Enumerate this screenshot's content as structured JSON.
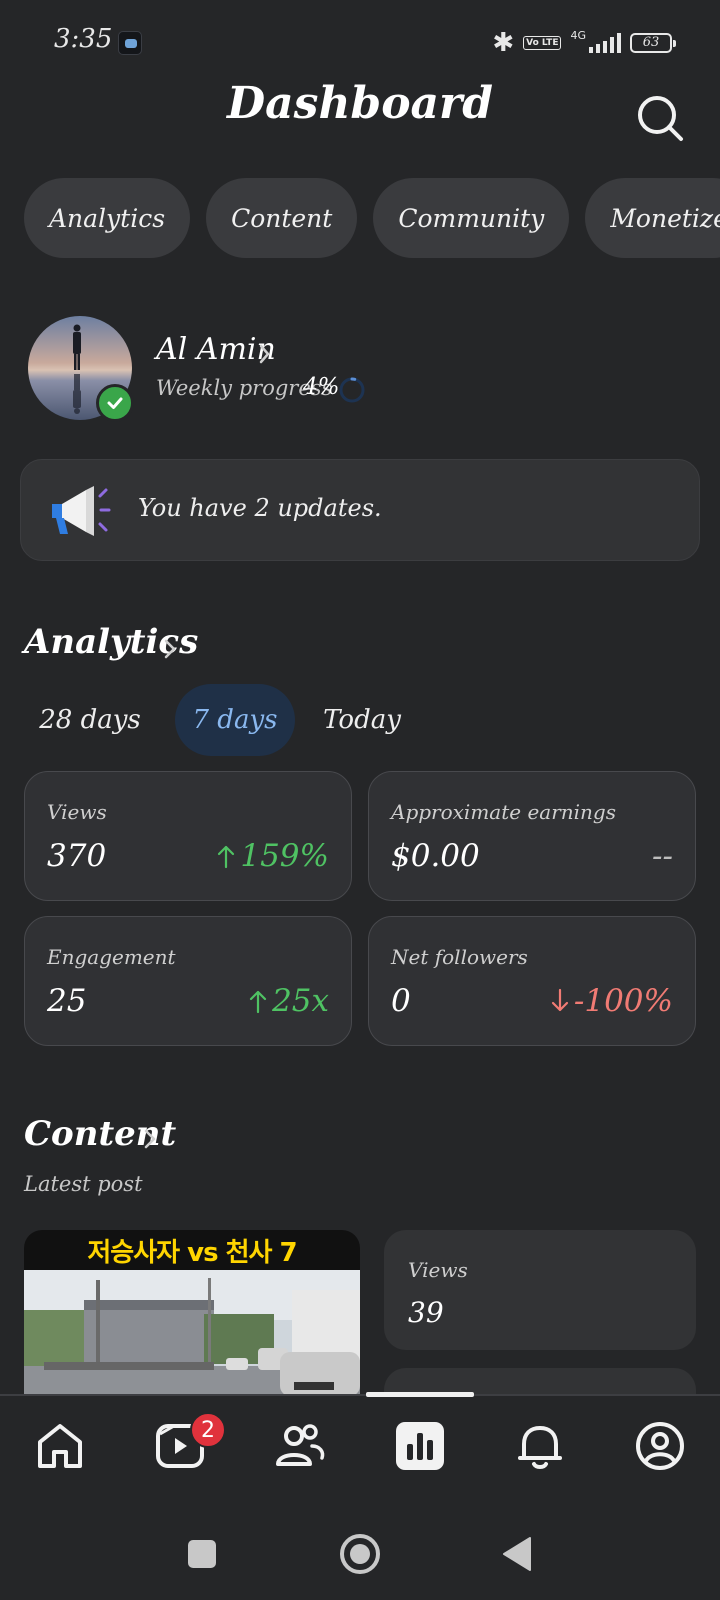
{
  "status_bar": {
    "time": "3:35",
    "network": "4G",
    "volte": "Vo LTE",
    "battery": "63"
  },
  "header": {
    "title": "Dashboard",
    "search_icon": "search-icon"
  },
  "chips": [
    "Analytics",
    "Content",
    "Community",
    "Monetize"
  ],
  "profile": {
    "name": "Al Amin",
    "progress_label": "Weekly progress",
    "progress_value": "4%",
    "progress_fraction": 0.04
  },
  "updates": {
    "text": "You have 2 updates.",
    "icon": "megaphone-icon"
  },
  "analytics": {
    "title": "Analytics",
    "ranges": [
      "28 days",
      "7 days",
      "Today"
    ],
    "active_range": "7 days",
    "metrics": [
      {
        "label": "Views",
        "value": "370",
        "change": "159%",
        "direction": "up"
      },
      {
        "label": "Approximate earnings",
        "value": "$0.00",
        "change": "--",
        "direction": "neutral"
      },
      {
        "label": "Engagement",
        "value": "25",
        "change": "25x",
        "direction": "up"
      },
      {
        "label": "Net followers",
        "value": "0",
        "change": "-100%",
        "direction": "down"
      }
    ]
  },
  "content": {
    "title": "Content",
    "subtitle": "Latest post",
    "thumbnail_title": "저승사자 vs 천사 7",
    "stats": [
      {
        "label": "Views",
        "value": "39"
      }
    ]
  },
  "bottom_nav": {
    "items": [
      "home-icon",
      "video-icon",
      "people-icon",
      "analytics-icon",
      "bell-icon",
      "profile-icon"
    ],
    "video_badge": "2",
    "active": "analytics-icon"
  },
  "colors": {
    "background": "#252628",
    "card": "#303134",
    "up": "#4fc263",
    "down": "#f17b74",
    "accent": "#8ab8ef",
    "badge": "#e0323c",
    "verified": "#3aa64a"
  }
}
